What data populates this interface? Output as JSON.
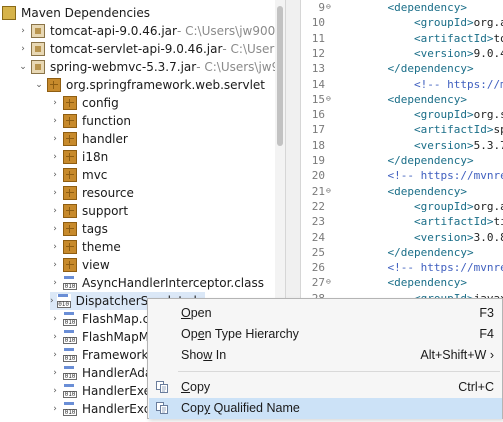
{
  "tree": {
    "root_label": "Maven Dependencies",
    "items": [
      {
        "kind": "jar",
        "twisty": "›",
        "label": "tomcat-api-9.0.46.jar",
        "suffix": " - C:\\Users\\jw900"
      },
      {
        "kind": "jar",
        "twisty": "›",
        "label": "tomcat-servlet-api-9.0.46.jar",
        "suffix": " - C:\\Users\\"
      },
      {
        "kind": "jar",
        "twisty": "⌄",
        "label": "spring-webmvc-5.3.7.jar",
        "suffix": " - C:\\Users\\jw9"
      },
      {
        "kind": "pkg",
        "twisty": "⌄",
        "label": "org.springframework.web.servlet",
        "suffix": ""
      },
      {
        "kind": "pkg",
        "twisty": "›",
        "label": "config",
        "suffix": ""
      },
      {
        "kind": "pkg",
        "twisty": "›",
        "label": "function",
        "suffix": ""
      },
      {
        "kind": "pkg",
        "twisty": "›",
        "label": "handler",
        "suffix": ""
      },
      {
        "kind": "pkg",
        "twisty": "›",
        "label": "i18n",
        "suffix": ""
      },
      {
        "kind": "pkg",
        "twisty": "›",
        "label": "mvc",
        "suffix": ""
      },
      {
        "kind": "pkg",
        "twisty": "›",
        "label": "resource",
        "suffix": ""
      },
      {
        "kind": "pkg",
        "twisty": "›",
        "label": "support",
        "suffix": ""
      },
      {
        "kind": "pkg",
        "twisty": "›",
        "label": "tags",
        "suffix": ""
      },
      {
        "kind": "pkg",
        "twisty": "›",
        "label": "theme",
        "suffix": ""
      },
      {
        "kind": "pkg",
        "twisty": "›",
        "label": "view",
        "suffix": ""
      },
      {
        "kind": "cls",
        "twisty": "›",
        "label": "AsyncHandlerInterceptor.class",
        "suffix": ""
      },
      {
        "kind": "cls",
        "twisty": "›",
        "label": "DispatcherServlet.class",
        "suffix": ""
      },
      {
        "kind": "cls",
        "twisty": "›",
        "label": "FlashMap.class",
        "suffix": ""
      },
      {
        "kind": "cls",
        "twisty": "›",
        "label": "FlashMapManager.class",
        "suffix": ""
      },
      {
        "kind": "cls",
        "twisty": "›",
        "label": "FrameworkServlet.class",
        "suffix": ""
      },
      {
        "kind": "cls",
        "twisty": "›",
        "label": "HandlerAdapter.class",
        "suffix": ""
      },
      {
        "kind": "cls",
        "twisty": "›",
        "label": "HandlerExecutionChain.class",
        "suffix": ""
      },
      {
        "kind": "cls",
        "twisty": "›",
        "label": "HandlerExceptionResolver.class",
        "suffix": ""
      }
    ]
  },
  "editor": {
    "lines": [
      {
        "num": "9",
        "fold": "⊖",
        "segments": [
          {
            "c": "tag",
            "t": "    <dependency>"
          }
        ]
      },
      {
        "num": "10",
        "fold": "",
        "segments": [
          {
            "c": "tag",
            "t": "        <groupId>"
          },
          {
            "c": "txt",
            "t": "org.apa"
          }
        ]
      },
      {
        "num": "11",
        "fold": "",
        "segments": [
          {
            "c": "tag",
            "t": "        <artifactId>"
          },
          {
            "c": "txt",
            "t": "tomc"
          }
        ]
      },
      {
        "num": "12",
        "fold": "",
        "segments": [
          {
            "c": "tag",
            "t": "        <version>"
          },
          {
            "c": "txt",
            "t": "9.0.46<"
          }
        ]
      },
      {
        "num": "13",
        "fold": "",
        "segments": [
          {
            "c": "tag",
            "t": "    </dependency>"
          }
        ]
      },
      {
        "num": "14",
        "fold": "",
        "segments": [
          {
            "c": "cmt",
            "t": "        <!-- https://mvn"
          }
        ]
      },
      {
        "num": "15",
        "fold": "⊖",
        "segments": [
          {
            "c": "tag",
            "t": "    <dependency>"
          }
        ]
      },
      {
        "num": "16",
        "fold": "",
        "segments": [
          {
            "c": "tag",
            "t": "        <groupId>"
          },
          {
            "c": "txt",
            "t": "org.spr"
          }
        ]
      },
      {
        "num": "17",
        "fold": "",
        "segments": [
          {
            "c": "tag",
            "t": "        <artifactId>"
          },
          {
            "c": "txt",
            "t": "spri"
          }
        ]
      },
      {
        "num": "18",
        "fold": "",
        "segments": [
          {
            "c": "tag",
            "t": "        <version>"
          },
          {
            "c": "txt",
            "t": "5.3.7<"
          }
        ]
      },
      {
        "num": "19",
        "fold": "",
        "segments": [
          {
            "c": "tag",
            "t": "    </dependency>"
          }
        ]
      },
      {
        "num": "20",
        "fold": "",
        "segments": [
          {
            "c": "cmt",
            "t": "    <!-- https://mvnrepo"
          }
        ]
      },
      {
        "num": "21",
        "fold": "⊖",
        "segments": [
          {
            "c": "tag",
            "t": "    <dependency>"
          }
        ]
      },
      {
        "num": "22",
        "fold": "",
        "segments": [
          {
            "c": "tag",
            "t": "        <groupId>"
          },
          {
            "c": "txt",
            "t": "org.apa"
          }
        ]
      },
      {
        "num": "23",
        "fold": "",
        "segments": [
          {
            "c": "tag",
            "t": "        <artifactId>"
          },
          {
            "c": "txt",
            "t": "tile"
          }
        ]
      },
      {
        "num": "24",
        "fold": "",
        "segments": [
          {
            "c": "tag",
            "t": "        <version>"
          },
          {
            "c": "txt",
            "t": "3.0.8<"
          }
        ]
      },
      {
        "num": "25",
        "fold": "",
        "segments": [
          {
            "c": "tag",
            "t": "    </dependency>"
          }
        ]
      },
      {
        "num": "26",
        "fold": "",
        "segments": [
          {
            "c": "cmt",
            "t": "    <!-- https://mvnrepo"
          }
        ]
      },
      {
        "num": "27",
        "fold": "⊖",
        "segments": [
          {
            "c": "tag",
            "t": "    <dependency>"
          }
        ]
      },
      {
        "num": "28",
        "fold": "",
        "segments": [
          {
            "c": "tag",
            "t": "        <groupId>"
          },
          {
            "c": "txt",
            "t": "javax.s"
          }
        ]
      }
    ]
  },
  "context_menu": {
    "items": [
      {
        "pre": "",
        "mn": "O",
        "post": "pen",
        "accel": "F3",
        "icon": "",
        "highlighted": false,
        "name": "menu-open"
      },
      {
        "pre": "Op",
        "mn": "e",
        "post": "n Type Hierarchy",
        "accel": "F4",
        "icon": "",
        "highlighted": false,
        "name": "menu-open-type-hierarchy"
      },
      {
        "pre": "Sho",
        "mn": "w",
        "post": " In",
        "accel": "Alt+Shift+W ›",
        "icon": "",
        "highlighted": false,
        "name": "menu-show-in"
      },
      {
        "pre": "",
        "mn": "C",
        "post": "opy",
        "accel": "Ctrl+C",
        "icon": "copy-icon",
        "highlighted": false,
        "name": "menu-copy"
      },
      {
        "pre": "Cop",
        "mn": "y",
        "post": " Qualified Name",
        "accel": "",
        "icon": "copy-qualified-icon",
        "highlighted": true,
        "name": "menu-copy-qualified-name"
      }
    ]
  }
}
